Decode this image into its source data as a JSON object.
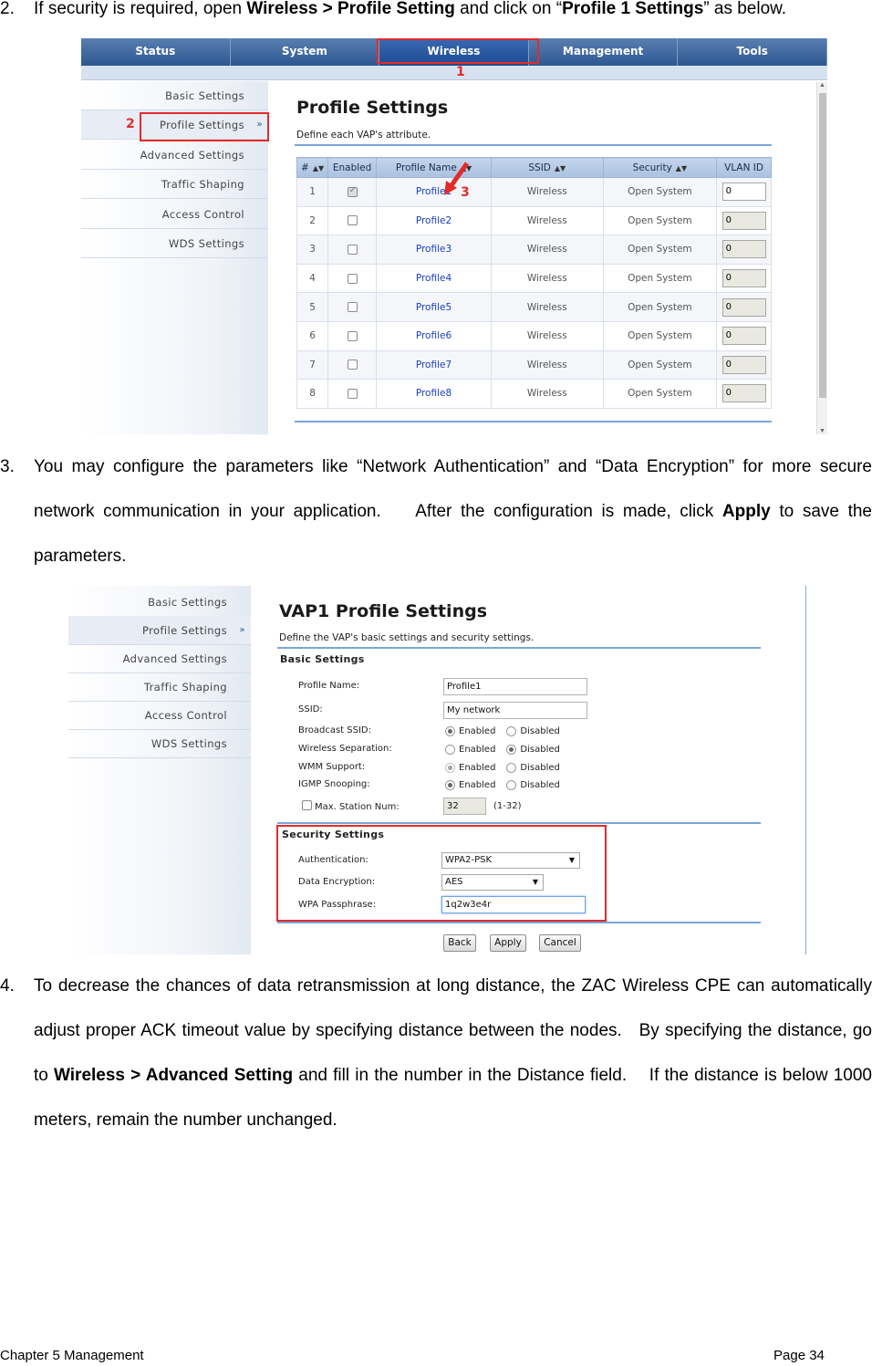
{
  "step2": {
    "num": "2.",
    "p1": "If security is required, open ",
    "b1": "Wireless > Profile Setting",
    "p2": " and click on “",
    "b2": "Profile 1 Settings",
    "p3": "” as below."
  },
  "shot1": {
    "nav": [
      "Status",
      "System",
      "Wireless",
      "Management",
      "Tools"
    ],
    "callouts": [
      "1",
      "2",
      "3"
    ],
    "sidebar": [
      "Basic Settings",
      "Profile Settings",
      "Advanced Settings",
      "Traffic Shaping",
      "Access Control",
      "WDS Settings"
    ],
    "sidebar_arrow": "»",
    "title": "Profile Settings",
    "subtitle": "Define each VAP's attribute.",
    "columns": [
      "#",
      "Enabled",
      "Profile Name",
      "SSID",
      "Security",
      "VLAN ID"
    ],
    "rows": [
      {
        "num": "1",
        "enabled": true,
        "name": "Profile1",
        "ssid": "Wireless",
        "security": "Open System",
        "vlan": "0"
      },
      {
        "num": "2",
        "enabled": false,
        "name": "Profile2",
        "ssid": "Wireless",
        "security": "Open System",
        "vlan": "0"
      },
      {
        "num": "3",
        "enabled": false,
        "name": "Profile3",
        "ssid": "Wireless",
        "security": "Open System",
        "vlan": "0"
      },
      {
        "num": "4",
        "enabled": false,
        "name": "Profile4",
        "ssid": "Wireless",
        "security": "Open System",
        "vlan": "0"
      },
      {
        "num": "5",
        "enabled": false,
        "name": "Profile5",
        "ssid": "Wireless",
        "security": "Open System",
        "vlan": "0"
      },
      {
        "num": "6",
        "enabled": false,
        "name": "Profile6",
        "ssid": "Wireless",
        "security": "Open System",
        "vlan": "0"
      },
      {
        "num": "7",
        "enabled": false,
        "name": "Profile7",
        "ssid": "Wireless",
        "security": "Open System",
        "vlan": "0"
      },
      {
        "num": "8",
        "enabled": false,
        "name": "Profile8",
        "ssid": "Wireless",
        "security": "Open System",
        "vlan": "0"
      }
    ]
  },
  "step3": {
    "num": "3.",
    "p1": "You may configure the parameters like “Network Authentication” and “Data Encryption” for more secure network communication in your application.    After the configuration is made, click ",
    "b1": "Apply",
    "p2": " to save the parameters."
  },
  "shot2": {
    "sidebar": [
      "Basic Settings",
      "Profile Settings",
      "Advanced Settings",
      "Traffic Shaping",
      "Access Control",
      "WDS Settings"
    ],
    "sidebar_arrow": "»",
    "title": "VAP1 Profile Settings",
    "subtitle": "Define the VAP's basic settings and security settings.",
    "basic_heading": "Basic Settings",
    "profile_name_label": "Profile Name:",
    "profile_name_value": "Profile1",
    "ssid_label": "SSID:",
    "ssid_value": "My network",
    "broadcast_label": "Broadcast SSID:",
    "wireless_sep_label": "Wireless Separation:",
    "wmm_label": "WMM Support:",
    "igmp_label": "IGMP Snooping:",
    "enabled_text": "Enabled",
    "disabled_text": "Disabled",
    "max_station_label": "Max. Station Num:",
    "max_station_value": "32",
    "max_station_range": "(1-32)",
    "security_heading": "Security Settings",
    "auth_label": "Authentication:",
    "auth_value": "WPA2-PSK",
    "enc_label": "Data Encryption:",
    "enc_value": "AES",
    "pass_label": "WPA Passphrase:",
    "pass_value": "1q2w3e4r",
    "caret": "▼",
    "buttons": {
      "back": "Back",
      "apply": "Apply",
      "cancel": "Cancel"
    }
  },
  "step4": {
    "num": "4.",
    "p1": "To decrease the chances of data retransmission at long distance, the ZAC Wireless CPE can automatically adjust proper ACK timeout value by specifying distance between the nodes.   By specifying the distance, go to ",
    "b1": "Wireless > Advanced Setting",
    "p2": " and fill in the number in the Distance field.    If the distance is below 1000 meters, remain the number unchanged."
  },
  "footer": {
    "chapter": "Chapter 5 Management",
    "page": "Page 34"
  },
  "colors": {
    "nav_blue": "#2c5791",
    "callout_red": "#e32b2b",
    "link_blue": "#1a3fc2"
  }
}
